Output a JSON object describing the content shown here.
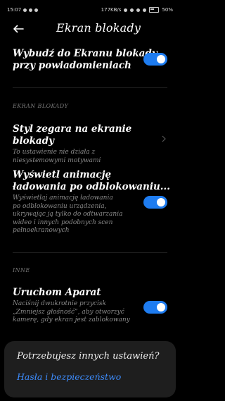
{
  "status": {
    "time": "15:07",
    "speed": "177KB/s",
    "battery": "50%"
  },
  "header": {
    "title": "Ekran blokady"
  },
  "wake": {
    "title_line1": "Wybudź do Ekranu blokady",
    "title_line2": "przy powiadomieniach",
    "enabled": true
  },
  "section_lock": {
    "label": "EKRAN BLOKADY"
  },
  "clock_style": {
    "title": "Styl zegara na ekranie blokady",
    "sub_line1": "To ustawienie nie działa z",
    "sub_line2": "niesystemowymi motywami"
  },
  "unlock_anim": {
    "title_line1": "Wyświetl animację",
    "title_line2": "ładowania po odblokowaniu...",
    "sub_line1": "Wyświetlaj animację ładowania",
    "sub_line2": "po odblokowaniu urządzenia,",
    "sub_line3": "ukrywając ją tylko do odtwarzania",
    "sub_line4": "wideo i innych podobnych scen",
    "sub_line5": "pełnoekranowych",
    "enabled": true
  },
  "section_other": {
    "label": "INNE"
  },
  "camera": {
    "title": "Uruchom Aparat",
    "sub_line1": "Naciśnij dwukrotnie przycisk",
    "sub_line2": "„Zmniejsz głośność”, aby otworzyć",
    "sub_line3": "kamerę, gdy ekran jest zablokowany",
    "enabled": true
  },
  "sheet": {
    "title": "Potrzebujesz innych ustawień?",
    "link": "Hasła i bezpieczeństwo"
  },
  "colors": {
    "accent": "#1e7cf0",
    "link": "#3d8dff",
    "background": "#000000"
  }
}
